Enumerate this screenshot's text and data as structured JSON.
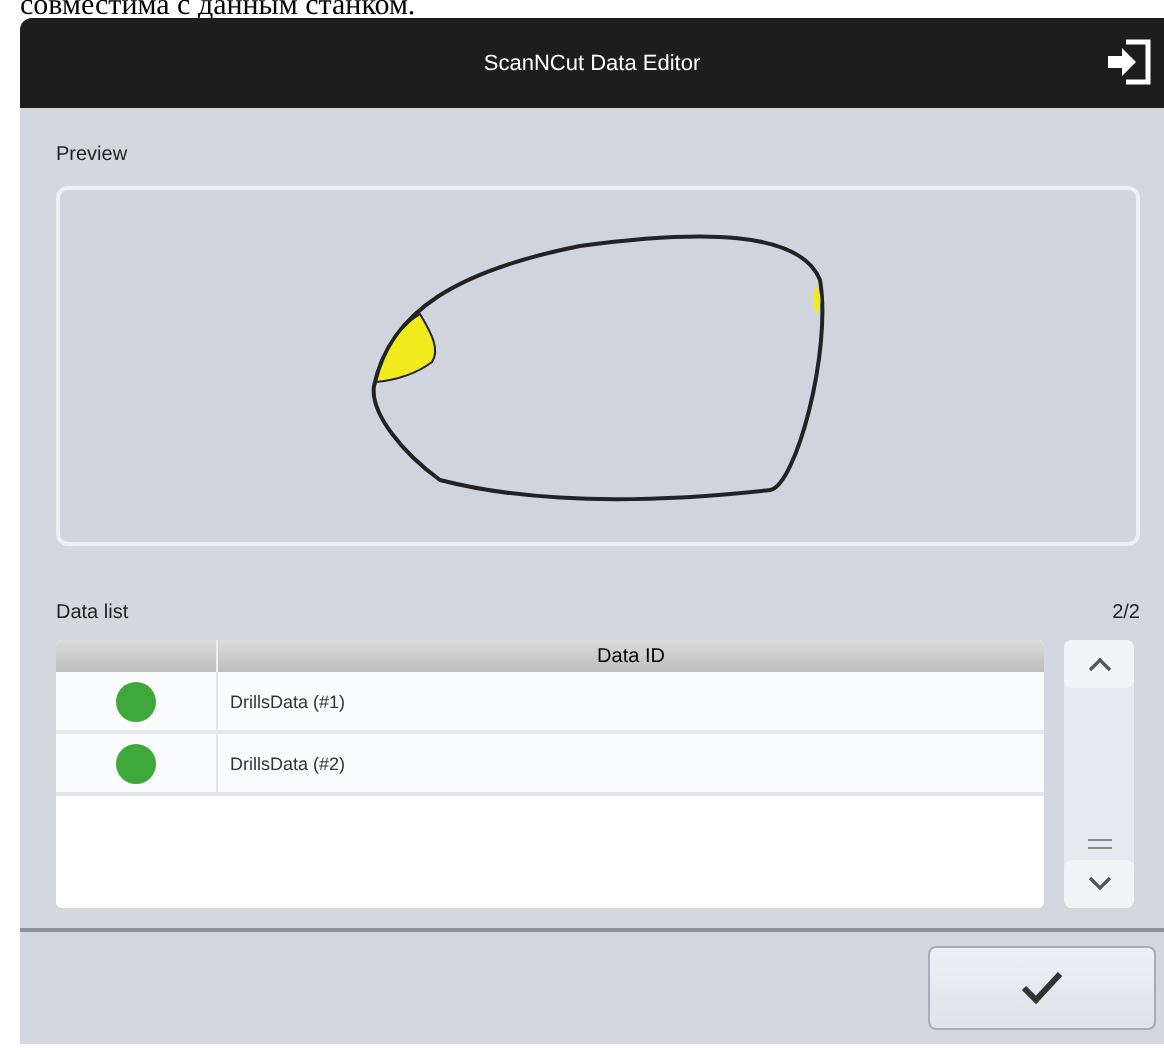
{
  "caption": "совместима с данным станком.",
  "window": {
    "title": "ScanNCut Data Editor"
  },
  "preview": {
    "label": "Preview"
  },
  "data_list": {
    "label": "Data list",
    "page": "2/2",
    "columns": [
      "Data ID"
    ],
    "rows": [
      {
        "color": "#3fa83a",
        "name": "DrillsData (#1)"
      },
      {
        "color": "#3fa83a",
        "name": "DrillsData (#2)"
      }
    ]
  }
}
